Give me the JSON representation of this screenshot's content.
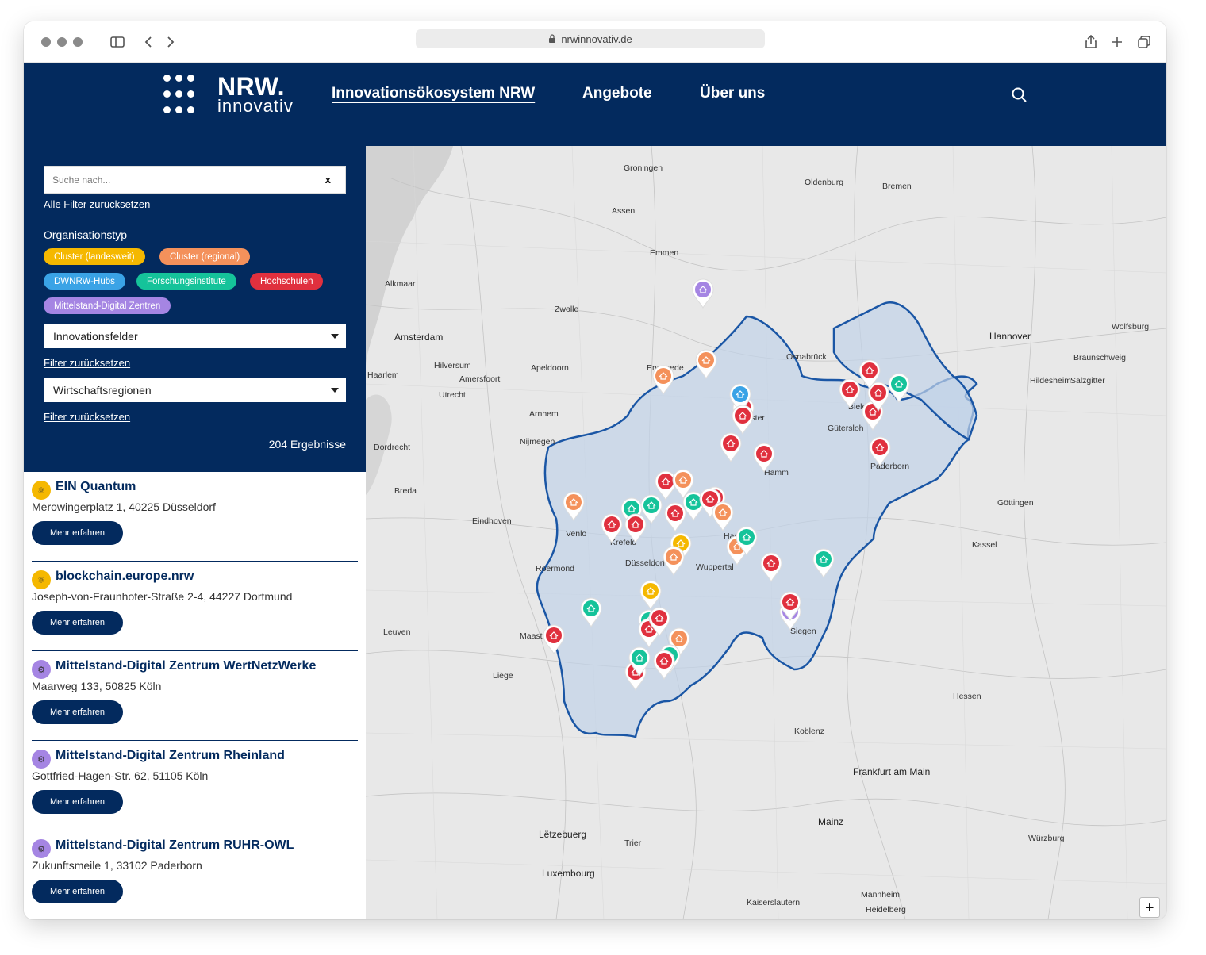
{
  "browser": {
    "url": "nrwinnovativ.de"
  },
  "header": {
    "logo_main": "NRW.",
    "logo_sub": "innovativ",
    "nav": [
      {
        "label": "Innovationsökosystem NRW"
      },
      {
        "label": "Angebote"
      },
      {
        "label": "Über uns"
      }
    ]
  },
  "sidebar": {
    "search_placeholder": "Suche nach...",
    "clear_label": "x",
    "reset_all": "Alle Filter zurücksetzen",
    "org_type_label": "Organisationstyp",
    "tags": [
      {
        "label": "Cluster (landesweit)",
        "color": "#f5b800"
      },
      {
        "label": "Cluster (regional)",
        "color": "#f4915b"
      },
      {
        "label": "DWNRW-Hubs",
        "color": "#3aa3e6"
      },
      {
        "label": "Forschungsinstitute",
        "color": "#15c39a"
      },
      {
        "label": "Hochschulen",
        "color": "#e0303e"
      },
      {
        "label": "Mittelstand-Digital Zentren",
        "color": "#a585e3"
      }
    ],
    "select1": "Innovationsfelder",
    "reset1": "Filter zurücksetzen",
    "select2": "Wirtschaftsregionen",
    "reset2": "Filter zurücksetzen",
    "results": "204 Ergebnisse"
  },
  "results": [
    {
      "title": "EIN Quantum",
      "address": "Merowingerplatz 1, 40225 Düsseldorf",
      "button": "Mehr erfahren",
      "color": "#f5b800"
    },
    {
      "title": "blockchain.europe.nrw",
      "address": "Joseph-von-Fraunhofer-Straße 2-4, 44227 Dortmund",
      "button": "Mehr erfahren",
      "color": "#f5b800"
    },
    {
      "title": "Mittelstand-Digital Zentrum WertNetzWerke",
      "address": "Maarweg 133, 50825 Köln",
      "button": "Mehr erfahren",
      "color": "#a585e3"
    },
    {
      "title": "Mittelstand-Digital Zentrum Rheinland",
      "address": "Gottfried-Hagen-Str. 62, 51105 Köln",
      "button": "Mehr erfahren",
      "color": "#a585e3"
    },
    {
      "title": "Mittelstand-Digital Zentrum RUHR-OWL",
      "address": "Zukunftsmeile 1, 33102 Paderborn",
      "button": "Mehr erfahren",
      "color": "#a585e3"
    }
  ],
  "map": {
    "zoom_in": "+",
    "cities": [
      {
        "name": "Amsterdam",
        "big": true
      },
      {
        "name": "Hannover",
        "big": true
      },
      {
        "name": "Frankfurt am Main",
        "big": true
      },
      {
        "name": "Luxembourg",
        "big": true
      },
      {
        "name": "Lëtzebuerg",
        "big": true
      },
      {
        "name": "Mainz",
        "big": true
      },
      {
        "name": "Oldenburg"
      },
      {
        "name": "Bremen"
      },
      {
        "name": "Osnabrück"
      },
      {
        "name": "Bielefeld"
      },
      {
        "name": "Paderborn"
      },
      {
        "name": "Gütersloh"
      },
      {
        "name": "Hamm"
      },
      {
        "name": "Münster"
      },
      {
        "name": "Düsseldorf"
      },
      {
        "name": "Krefeld"
      },
      {
        "name": "Hagen"
      },
      {
        "name": "Siegen"
      },
      {
        "name": "Maastricht"
      },
      {
        "name": "Liège"
      },
      {
        "name": "Leuven"
      },
      {
        "name": "Eindhoven"
      },
      {
        "name": "Arnhem"
      },
      {
        "name": "Nijmegen"
      },
      {
        "name": "Apeldoorn"
      },
      {
        "name": "Utrecht"
      },
      {
        "name": "Zwolle"
      },
      {
        "name": "Enschede"
      },
      {
        "name": "Emmen"
      },
      {
        "name": "Assen"
      },
      {
        "name": "Groningen"
      },
      {
        "name": "Kassel"
      },
      {
        "name": "Göttingen"
      },
      {
        "name": "Koblenz"
      },
      {
        "name": "Trier"
      },
      {
        "name": "Mannheim"
      },
      {
        "name": "Heidelberg"
      },
      {
        "name": "Kaiserslautern"
      },
      {
        "name": "Würzburg"
      },
      {
        "name": "Hildesheim"
      },
      {
        "name": "Salzgitter"
      },
      {
        "name": "Braunschweig"
      },
      {
        "name": "Wolfsburg"
      },
      {
        "name": "Hessen"
      },
      {
        "name": "Alkmaar"
      },
      {
        "name": "Haarlem"
      },
      {
        "name": "Hilversum"
      },
      {
        "name": "Amersfoort"
      },
      {
        "name": "Breda"
      },
      {
        "name": "Dordrecht"
      },
      {
        "name": "Roermond"
      },
      {
        "name": "Venlo"
      },
      {
        "name": "Wuppertal"
      }
    ],
    "pins": [
      {
        "c": "#a585e3"
      },
      {
        "c": "#f4915b"
      },
      {
        "c": "#f4915b"
      },
      {
        "c": "#e0303e"
      },
      {
        "c": "#3aa3e6"
      },
      {
        "c": "#e0303e"
      },
      {
        "c": "#e0303e"
      },
      {
        "c": "#e0303e"
      },
      {
        "c": "#15c39a"
      },
      {
        "c": "#e0303e"
      },
      {
        "c": "#e0303e"
      },
      {
        "c": "#e0303e"
      },
      {
        "c": "#e0303e"
      },
      {
        "c": "#e0303e"
      },
      {
        "c": "#f4915b"
      },
      {
        "c": "#e0303e"
      },
      {
        "c": "#15c39a"
      },
      {
        "c": "#e0303e"
      },
      {
        "c": "#15c39a"
      },
      {
        "c": "#e0303e"
      },
      {
        "c": "#e0303e"
      },
      {
        "c": "#f4915b"
      },
      {
        "c": "#e0303e"
      },
      {
        "c": "#15c39a"
      },
      {
        "c": "#f5b800"
      },
      {
        "c": "#f4915b"
      },
      {
        "c": "#e0303e"
      },
      {
        "c": "#f4915b"
      },
      {
        "c": "#f4915b"
      },
      {
        "c": "#15c39a"
      },
      {
        "c": "#e0303e"
      },
      {
        "c": "#a585e3"
      },
      {
        "c": "#15c39a"
      },
      {
        "c": "#e0303e"
      },
      {
        "c": "#f5b800"
      },
      {
        "c": "#15c39a"
      },
      {
        "c": "#e0303e"
      },
      {
        "c": "#15c39a"
      },
      {
        "c": "#f4915b"
      },
      {
        "c": "#15c39a"
      },
      {
        "c": "#e0303e"
      },
      {
        "c": "#e0303e"
      },
      {
        "c": "#e0303e"
      },
      {
        "c": "#15c39a"
      },
      {
        "c": "#e0303e"
      }
    ]
  }
}
